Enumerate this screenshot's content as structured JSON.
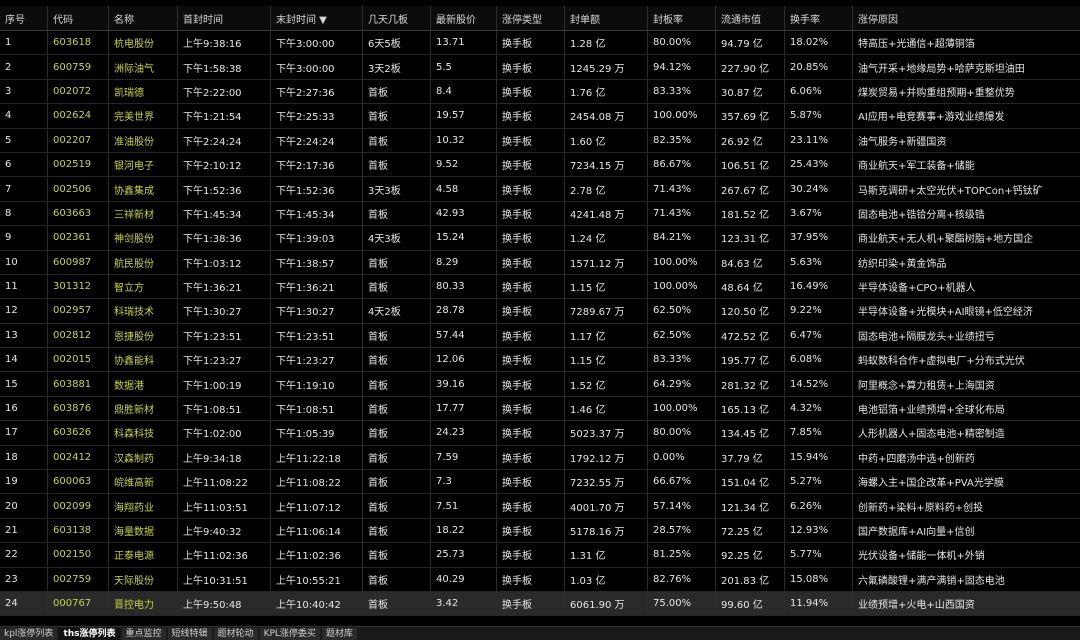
{
  "columns": [
    "序号",
    "代码",
    "名称",
    "首封时间",
    "末封时间 ▼",
    "几天几板",
    "最新股价",
    "涨停类型",
    "封单额",
    "封板率",
    "流通市值",
    "换手率",
    "涨停原因"
  ],
  "rows": [
    [
      "1",
      "603618",
      "杭电股份",
      "上午9:38:16",
      "下午3:00:00",
      "6天5板",
      "13.71",
      "换手板",
      "1.28 亿",
      "80.00%",
      "94.79 亿",
      "18.02%",
      "特高压+光通信+超薄铜箔"
    ],
    [
      "2",
      "600759",
      "洲际油气",
      "下午1:58:38",
      "下午3:00:00",
      "3天2板",
      "5.5",
      "换手板",
      "1245.29 万",
      "94.12%",
      "227.90 亿",
      "20.85%",
      "油气开采+地缘局势+哈萨克斯坦油田"
    ],
    [
      "3",
      "002072",
      "凯瑞德",
      "下午2:22:00",
      "下午2:27:36",
      "首板",
      "8.4",
      "换手板",
      "1.76 亿",
      "83.33%",
      "30.87 亿",
      "6.06%",
      "煤炭贸易+并购重组预期+重整优势"
    ],
    [
      "4",
      "002624",
      "完美世界",
      "下午1:21:54",
      "下午2:25:33",
      "首板",
      "19.57",
      "换手板",
      "2454.08 万",
      "100.00%",
      "357.69 亿",
      "5.87%",
      "AI应用+电竞赛事+游戏业绩爆发"
    ],
    [
      "5",
      "002207",
      "准油股份",
      "下午2:24:24",
      "下午2:24:24",
      "首板",
      "10.32",
      "换手板",
      "1.60 亿",
      "82.35%",
      "26.92 亿",
      "23.11%",
      "油气服务+新疆国资"
    ],
    [
      "6",
      "002519",
      "银河电子",
      "下午2:10:12",
      "下午2:17:36",
      "首板",
      "9.52",
      "换手板",
      "7234.15 万",
      "86.67%",
      "106.51 亿",
      "25.43%",
      "商业航天+军工装备+储能"
    ],
    [
      "7",
      "002506",
      "协鑫集成",
      "下午1:52:36",
      "下午1:52:36",
      "3天3板",
      "4.58",
      "换手板",
      "2.78 亿",
      "71.43%",
      "267.67 亿",
      "30.24%",
      "马斯克调研+太空光伏+TOPCon+钙钛矿"
    ],
    [
      "8",
      "603663",
      "三祥新材",
      "下午1:45:34",
      "下午1:45:34",
      "首板",
      "42.93",
      "换手板",
      "4241.48 万",
      "71.43%",
      "181.52 亿",
      "3.67%",
      "固态电池+锆铪分离+核级锆"
    ],
    [
      "9",
      "002361",
      "神剑股份",
      "下午1:38:36",
      "下午1:39:03",
      "4天3板",
      "15.24",
      "换手板",
      "1.24 亿",
      "84.21%",
      "123.31 亿",
      "37.95%",
      "商业航天+无人机+聚酯树脂+地方国企"
    ],
    [
      "10",
      "600987",
      "航民股份",
      "下午1:03:12",
      "下午1:38:57",
      "首板",
      "8.29",
      "换手板",
      "1571.12 万",
      "100.00%",
      "84.63 亿",
      "5.63%",
      "纺织印染+黄金饰品"
    ],
    [
      "11",
      "301312",
      "智立方",
      "下午1:36:21",
      "下午1:36:21",
      "首板",
      "80.33",
      "换手板",
      "1.15 亿",
      "100.00%",
      "48.64 亿",
      "16.49%",
      "半导体设备+CPO+机器人"
    ],
    [
      "12",
      "002957",
      "科瑞技术",
      "下午1:30:27",
      "下午1:30:27",
      "4天2板",
      "28.78",
      "换手板",
      "7289.67 万",
      "62.50%",
      "120.50 亿",
      "9.22%",
      "半导体设备+光模块+AI眼镜+低空经济"
    ],
    [
      "13",
      "002812",
      "恩捷股份",
      "下午1:23:51",
      "下午1:23:51",
      "首板",
      "57.44",
      "换手板",
      "1.17 亿",
      "62.50%",
      "472.52 亿",
      "6.47%",
      "固态电池+隔膜龙头+业绩扭亏"
    ],
    [
      "14",
      "002015",
      "协鑫能科",
      "下午1:23:27",
      "下午1:23:27",
      "首板",
      "12.06",
      "换手板",
      "1.15 亿",
      "83.33%",
      "195.77 亿",
      "6.08%",
      "蚂蚁数科合作+虚拟电厂+分布式光伏"
    ],
    [
      "15",
      "603881",
      "数据港",
      "下午1:00:19",
      "下午1:19:10",
      "首板",
      "39.16",
      "换手板",
      "1.52 亿",
      "64.29%",
      "281.32 亿",
      "14.52%",
      "阿里概念+算力租赁+上海国资"
    ],
    [
      "16",
      "603876",
      "鼎胜新材",
      "下午1:08:51",
      "下午1:08:51",
      "首板",
      "17.77",
      "换手板",
      "1.46 亿",
      "100.00%",
      "165.13 亿",
      "4.32%",
      "电池铝箔+业绩预增+全球化布局"
    ],
    [
      "17",
      "603626",
      "科森科技",
      "下午1:02:00",
      "下午1:05:39",
      "首板",
      "24.23",
      "换手板",
      "5023.37 万",
      "80.00%",
      "134.45 亿",
      "7.85%",
      "人形机器人+固态电池+精密制造"
    ],
    [
      "18",
      "002412",
      "汉森制药",
      "上午9:34:18",
      "上午11:22:18",
      "首板",
      "7.59",
      "换手板",
      "1792.12 万",
      "0.00%",
      "37.79 亿",
      "15.94%",
      "中药+四磨汤中选+创新药"
    ],
    [
      "19",
      "600063",
      "皖维高新",
      "上午11:08:22",
      "上午11:08:22",
      "首板",
      "7.3",
      "换手板",
      "7232.55 万",
      "66.67%",
      "151.04 亿",
      "5.27%",
      "海螺入主+国企改革+PVA光学膜"
    ],
    [
      "20",
      "002099",
      "海翔药业",
      "上午11:03:51",
      "上午11:07:12",
      "首板",
      "7.51",
      "换手板",
      "4001.70 万",
      "57.14%",
      "121.34 亿",
      "6.26%",
      "创新药+染料+原料药+创投"
    ],
    [
      "21",
      "603138",
      "海量数据",
      "上午9:40:32",
      "上午11:06:14",
      "首板",
      "18.22",
      "换手板",
      "5178.16 万",
      "28.57%",
      "72.25 亿",
      "12.93%",
      "国产数据库+AI向量+信创"
    ],
    [
      "22",
      "002150",
      "正泰电源",
      "上午11:02:36",
      "上午11:02:36",
      "首板",
      "25.73",
      "换手板",
      "1.31 亿",
      "81.25%",
      "92.25 亿",
      "5.77%",
      "光伏设备+储能一体机+外销"
    ],
    [
      "23",
      "002759",
      "天际股份",
      "上午10:31:51",
      "上午10:55:21",
      "首板",
      "40.29",
      "换手板",
      "1.03 亿",
      "82.76%",
      "201.83 亿",
      "15.08%",
      "六氟磷酸锂+满产满销+固态电池"
    ],
    [
      "24",
      "000767",
      "晋控电力",
      "上午9:50:48",
      "上午10:40:42",
      "首板",
      "3.42",
      "换手板",
      "6061.90 万",
      "75.00%",
      "99.60 亿",
      "11.94%",
      "业绩预增+火电+山西国资"
    ]
  ],
  "selected_row": 23,
  "tabs": [
    "kpl涨停列表",
    "ths涨停列表",
    "重点监控",
    "短线特辑",
    "题材轮动",
    "KPL涨停委买",
    "题材库"
  ],
  "active_tab": 1,
  "colors": {
    "code": "#c7d34a",
    "name": "#c7d34a",
    "background": "#000000"
  }
}
